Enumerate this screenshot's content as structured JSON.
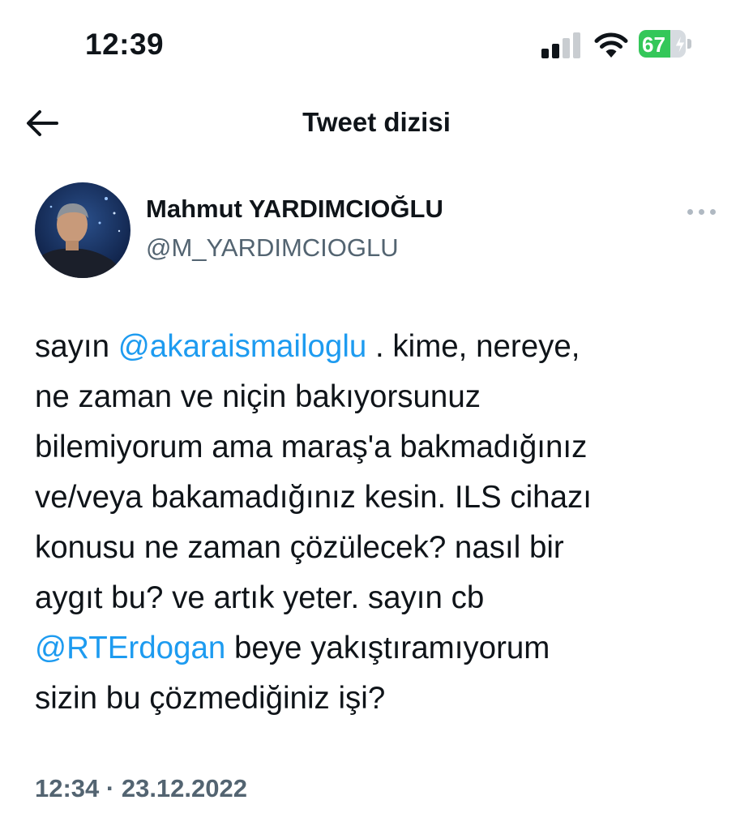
{
  "status_bar": {
    "time": "12:39",
    "battery_percent": "67",
    "battery_level": 0.67,
    "signal_bars_active": 2,
    "signal_bars_total": 4
  },
  "header": {
    "title": "Tweet dizisi",
    "back_icon": "arrow-left-icon"
  },
  "author": {
    "name": "Mahmut YARDIMCIOĞLU",
    "handle": "@M_YARDIMCIOGLU",
    "more_icon": "more-horizontal-icon"
  },
  "tweet": {
    "lines": [
      [
        {
          "t": "sayın "
        },
        {
          "t": "@akaraismailoglu",
          "m": true
        },
        {
          "t": " . kime, nereye,"
        }
      ],
      [
        {
          "t": "ne zaman ve niçin bakıyorsunuz"
        }
      ],
      [
        {
          "t": "bilemiyorum ama maraş'a bakmadığınız"
        }
      ],
      [
        {
          "t": "ve/veya bakamadığınız kesin. ILS cihazı"
        }
      ],
      [
        {
          "t": "konusu ne zaman çözülecek? nasıl bir"
        }
      ],
      [
        {
          "t": "aygıt bu? ve artık yeter. sayın cb"
        }
      ],
      [
        {
          "t": "@RTErdogan",
          "m": true
        },
        {
          "t": " beye yakıştıramıyorum"
        }
      ],
      [
        {
          "t": "sizin bu çözmediğiniz işi?"
        }
      ]
    ],
    "timestamp": "12:34 · 23.12.2022"
  },
  "colors": {
    "text": "#0f1419",
    "secondary": "#536471",
    "mention": "#1d9bf0",
    "battery": "#34c759"
  }
}
